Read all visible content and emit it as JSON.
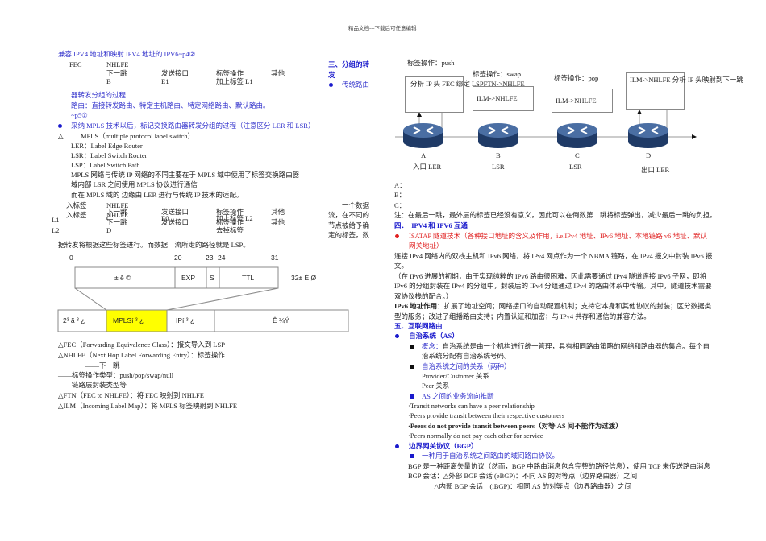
{
  "header": "精品文档---下载后可任意编辑",
  "left": {
    "title": "兼容 IPV4 地址和映射 IPV4 地址的 IPV6~p4②",
    "t1": {
      "fec": "FEC",
      "nhlfe": "NHLFE",
      "h": [
        "下一跳",
        "发送接口",
        "标签操作",
        "其他"
      ],
      "r": [
        "B",
        "E1",
        "加上标签 L1"
      ]
    },
    "blue_lines": [
      "器转发分组的过程",
      "路由：直接转发路由、特定主机路由、特定网络路由、默认路由。",
      "~p5①"
    ],
    "bullet1": "采纳 MPLS 技术以后，标记交换路由器转发分组的过程（注意区分 LER 和 LSR）",
    "tri": "△",
    "mpls": "MPLS（multiple protocol label switch）",
    "lines": [
      "LER：Label Edge Router",
      "LSR：Label Switch Router",
      "LSP：Label Switch Path",
      "MPLS 网络与传统 IP 网络的不同主要在于 MPLS 域中使用了标签交换路由器",
      "域内部 LSR 之间使用 MPLS 协议进行通信",
      "而在 MPLS 域的 边缘由 LER 进行与传统 IP 技术的适配。"
    ],
    "t2": {
      "in": "入标签",
      "nhlfe": "NHLFE",
      "h": [
        "下一跳",
        "发送接口",
        "标签操作",
        "其他"
      ],
      "l1": "L1",
      "l2": "L2",
      "r1": [
        "C",
        "E0",
        "加上标签 L2"
      ],
      "r2": [
        "D",
        "去掉标签"
      ]
    },
    "side": [
      "一个数据",
      "流，在不同的",
      "节点被给予确",
      "定的标签，数"
    ],
    "lsp_line": "据转发将根据这些标签进行。而数据　流所走的路径就是 LSP。",
    "diagram": {
      "bits": [
        "0",
        "20",
        "23",
        "24",
        "31"
      ],
      "top": [
        "± ê ©",
        "EXP",
        "S",
        "TTL"
      ],
      "side": "32± È Ø",
      "bottom": [
        "2³ ã ³ ¿",
        "MPLSí ³ ¿",
        "IPí ³ ¿",
        "Ê ¾Ý"
      ],
      "highlight": "#ffff00"
    },
    "defs": [
      "△FEC（Forwarding Equivalence Class）：报文导入到 LSP",
      "△NHLFE（Next Hop Label Forwarding Entry）：标签操作",
      "——下一跳",
      "——标签操作类型：push/pop/swap/null",
      "——链路层封装类型等",
      "△FTN（FEC to NHLFE）：将 FEC 映射到 NHLFE",
      "△ILM（Incoming Label Map）：将 MPLS 标签映射到 NHLFE"
    ]
  },
  "mid": {
    "sec3": "三、分组的转",
    "sec3b": "发",
    "trad": "传统路由"
  },
  "net": {
    "ops": [
      "标签操作：push",
      "标签操作：swap",
      "标签操作：pop"
    ],
    "boxes": [
      "分析 IP 头 FEC 绑定 LSPFTN->NHLFE",
      "ILM->NHLFE",
      "ILM->NHLFE",
      "ILM->NHLFE 分析 IP 头映射到下一跳"
    ],
    "nodes": [
      "A",
      "B",
      "C",
      "D"
    ],
    "roles": [
      "入口 LER",
      "LSR",
      "LSR",
      "出口 LER"
    ]
  },
  "right": {
    "abc": [
      "A：",
      "B：",
      "C："
    ],
    "note": "注：在最后一跳，最外层的标签已经没有意义，因此可以在倒数第二跳将标签弹出，减少最后一跳的负担。",
    "sec4": "四．　IPV4 和 IPV6 互通",
    "isatap": [
      "ISATAP 隧道技术（各种接口地址的含义及作用，i.e.IPv4 地址、IPv6 地址、本地链路 v6 地址、默认",
      "网关地址）"
    ],
    "para1": [
      "连接 IPv4 网络内的双栈主机和 IPv6 网络，将 IPv4 网点作为一个 NBMA 链路，在 IPv4 报文中封装 IPv6 报",
      "文。",
      "（在 IPv6 进展的初期，由于实现纯粹的 IPv6 路由很困难，因此需要通过 IPv4 隧道连接 IPv6 子网，即将",
      "IPv6 的分组封装在 IPv4 的分组中，封装后的 IPv4 分组通过 IPv4 的路由体系中传输。其中，隧道技术需要",
      "双协议栈的配合。）"
    ],
    "ipv6_label": "IPv6 地址作用：",
    "ipv6_text": "扩展了地址空间；网络接口的自动配置机制；支持它本身和其他协议的封装；区分数据类",
    "ipv6_text2": "型的服务；改进了组播路由支持；内置认证和加密；与 IPv4 共存和通信的兼容方法。",
    "sec5": "五．互联网路由",
    "as": "自治系统（AS）",
    "concept_label": "概念：",
    "concept": "自治系统是由一个机构进行统一管理，具有相同路由策略的网络和路由器的集合。每个自",
    "concept2": "治系统分配有自治系统号码。",
    "rel": "自治系统之间的关系（两种）",
    "rel_items": [
      "Provider/Customer 关系",
      "Peer 关系"
    ],
    "flow": "AS 之间的业务流向推断",
    "flow_items": [
      "·Transit networks can have a peer relationship",
      "·Peers provide transit between their respective customers",
      "·Peers do not provide transit between peers（对等 AS 间不能作为过渡）",
      "·Peers normally do not pay each other for service"
    ],
    "bgp": "边界网关协议（BGP）",
    "bgp_def": "一种用于自治系统之间路由的域间路由协议。",
    "bgp_lines": [
      "BGP 是一种距离矢量协议（然而，BGP 中路由消息包含完整的路径信息），使用 TCP 来传送路由消息",
      "BGP 会话：△外部 BGP 会话 (eBGP)：不同 AS 的对等点（边界路由器）之间",
      "△内部 BGP 会话　(iBGP)：相同 AS 的对等点（边界路由器）之间"
    ]
  }
}
